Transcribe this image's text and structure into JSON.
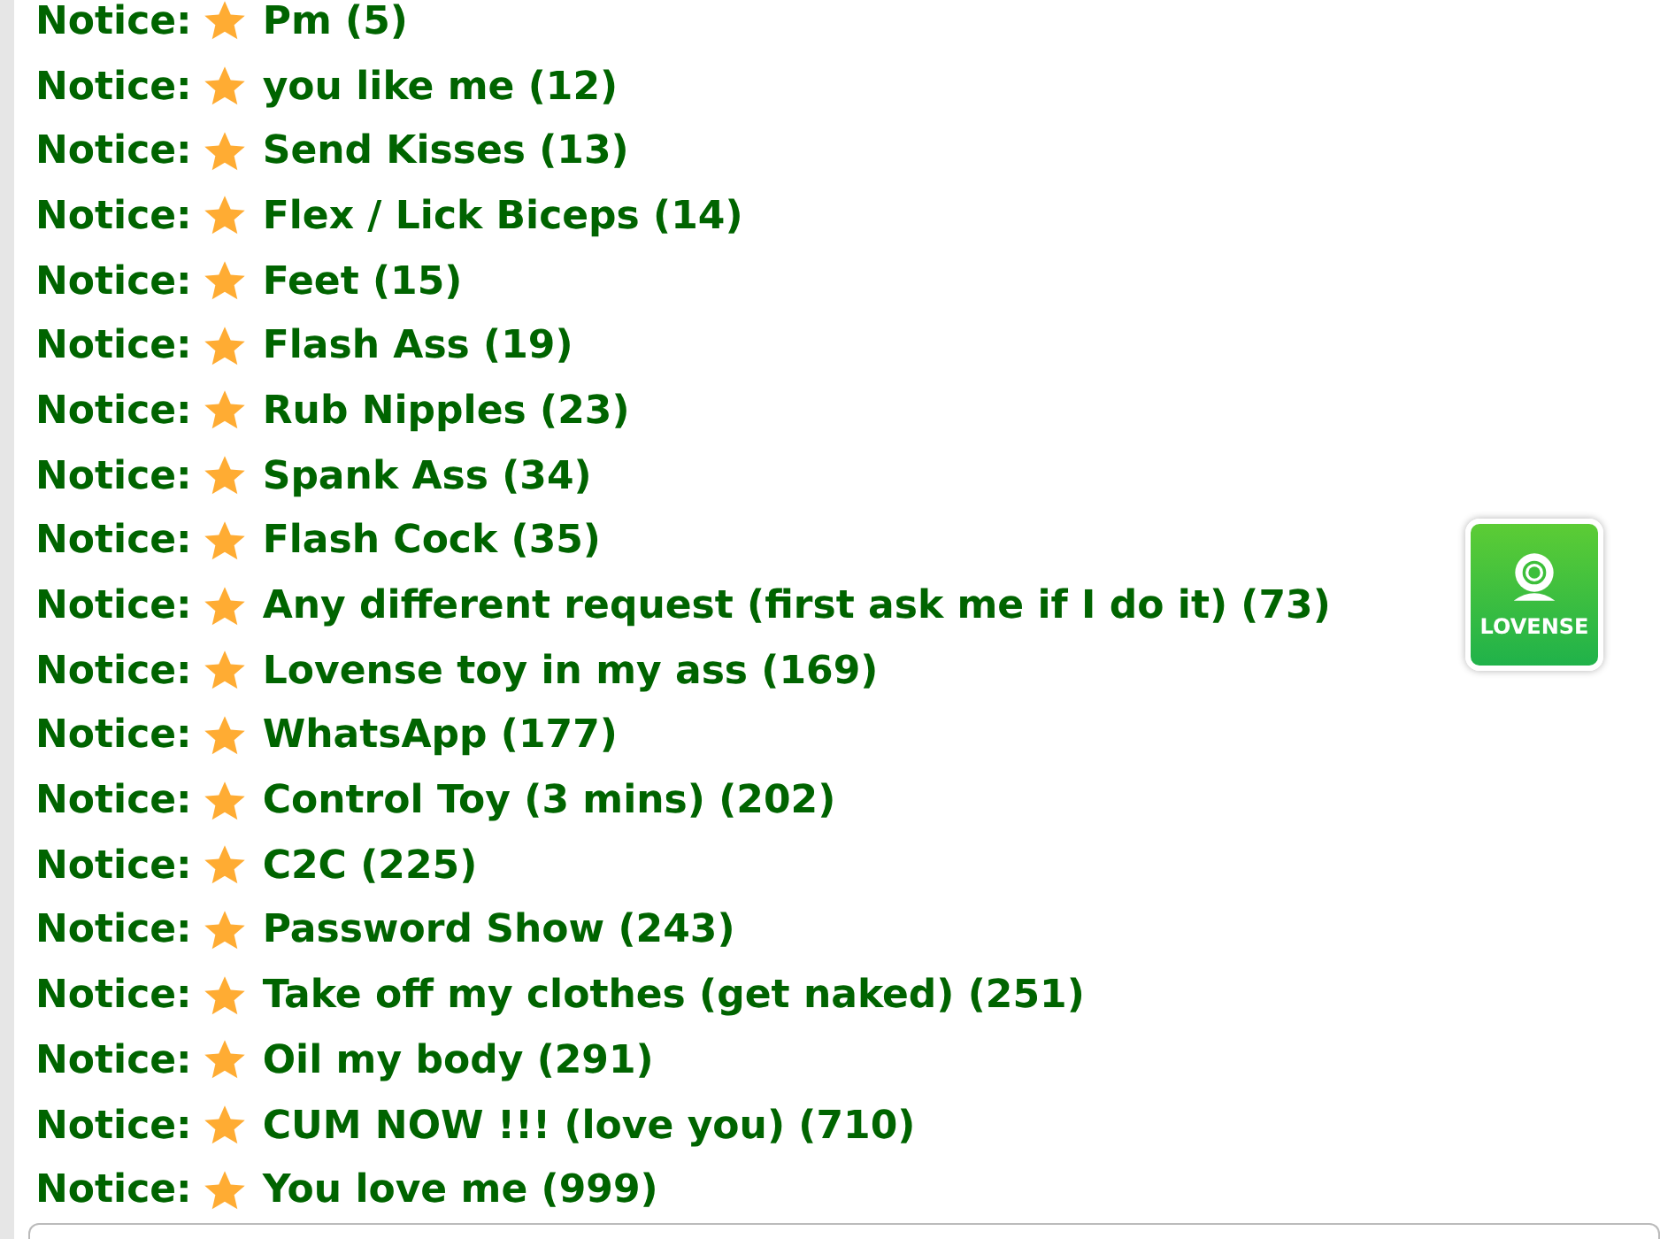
{
  "messages": [
    {
      "prefix": "Notice:",
      "text": "Pm (5)"
    },
    {
      "prefix": "Notice:",
      "text": "you like me (12)"
    },
    {
      "prefix": "Notice:",
      "text": "Send Kisses (13)"
    },
    {
      "prefix": "Notice:",
      "text": "Flex / Lick Biceps (14)"
    },
    {
      "prefix": "Notice:",
      "text": "Feet (15)"
    },
    {
      "prefix": "Notice:",
      "text": "Flash Ass (19)"
    },
    {
      "prefix": "Notice:",
      "text": "Rub Nipples (23)"
    },
    {
      "prefix": "Notice:",
      "text": "Spank Ass (34)"
    },
    {
      "prefix": "Notice:",
      "text": "Flash Cock (35)"
    },
    {
      "prefix": "Notice:",
      "text": "Any different request (first ask me if I do it) (73)"
    },
    {
      "prefix": "Notice:",
      "text": "Lovense toy in my ass (169)"
    },
    {
      "prefix": "Notice:",
      "text": "WhatsApp (177)"
    },
    {
      "prefix": "Notice:",
      "text": "Control Toy (3 mins) (202)"
    },
    {
      "prefix": "Notice:",
      "text": "C2C (225)"
    },
    {
      "prefix": "Notice:",
      "text": "Password Show (243)"
    },
    {
      "prefix": "Notice:",
      "text": "Take off my clothes (get naked) (251)"
    },
    {
      "prefix": "Notice:",
      "text": "Oil my body (291)"
    },
    {
      "prefix": "Notice:",
      "text": "CUM NOW !!! (love you) (710)"
    },
    {
      "prefix": "Notice:",
      "text": "You love me (999)"
    }
  ],
  "lovense_button": {
    "label": "LOVENSE"
  }
}
